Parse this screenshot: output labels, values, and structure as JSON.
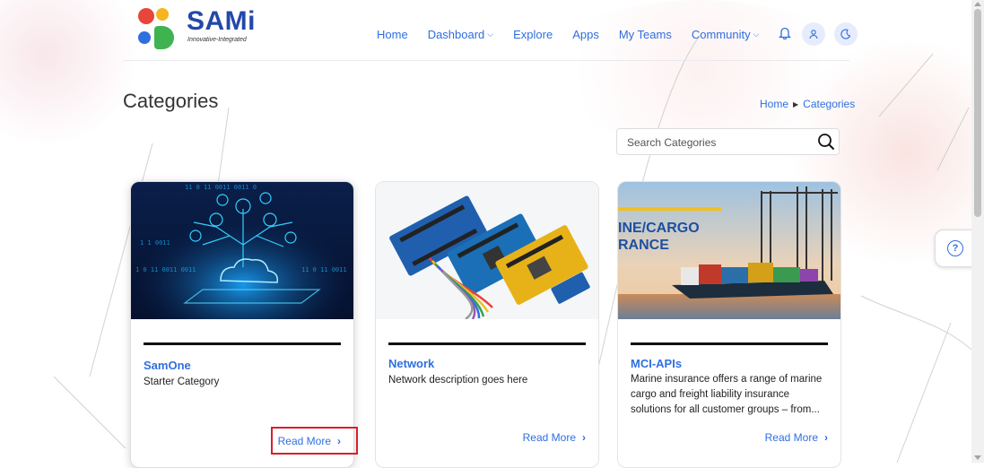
{
  "brand": {
    "name": "SAMi",
    "tagline": "Innovative-Integrated"
  },
  "nav": {
    "items": [
      "Home",
      "Dashboard",
      "Explore",
      "Apps",
      "My Teams",
      "Community"
    ]
  },
  "page": {
    "title": "Categories"
  },
  "breadcrumb": {
    "home": "Home",
    "current": "Categories"
  },
  "search": {
    "placeholder": "Search Categories"
  },
  "cards": [
    {
      "title": "SamOne",
      "description": "Starter Category",
      "cta": "Read More",
      "image": "cloud-circuit-image",
      "image_text": ""
    },
    {
      "title": "Network",
      "description": "Network description goes here",
      "cta": "Read More",
      "image": "arduino-boards-image",
      "image_text": ""
    },
    {
      "title": "MCI-APIs",
      "description": "Marine insurance offers a range of marine cargo and freight liability insurance solutions for all customer groups – from...",
      "cta": "Read More",
      "image": "cargo-ship-image",
      "image_text": "INE/CARGO\nRANCE"
    }
  ],
  "colors": {
    "accent": "#2f6fe0",
    "highlight": "#d9202a"
  }
}
